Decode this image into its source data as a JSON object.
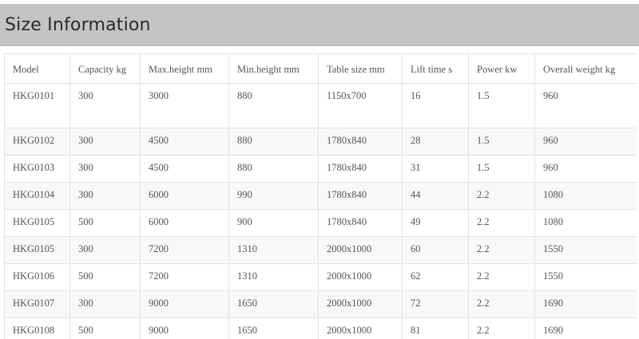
{
  "section": {
    "title": "Size Information"
  },
  "table": {
    "headers": [
      "Model",
      "Capacity kg",
      "Max.height mm",
      "Min.height mm",
      "Table size mm",
      "Lift time s",
      "Power kw",
      "Overall weight kg"
    ],
    "rows": [
      [
        "HKG0101",
        "300",
        "3000",
        "880",
        "1150x700",
        "16",
        "1.5",
        "960"
      ],
      [
        "HKG0102",
        "300",
        "4500",
        "880",
        "1780x840",
        "28",
        "1.5",
        "960"
      ],
      [
        "HKG0103",
        "300",
        "4500",
        "880",
        "1780x840",
        "31",
        "1.5",
        "960"
      ],
      [
        "HKG0104",
        "300",
        "6000",
        "990",
        "1780x840",
        "44",
        "2.2",
        "1080"
      ],
      [
        "HKG0105",
        "500",
        "6000",
        "900",
        "1780x840",
        "49",
        "2.2",
        "1080"
      ],
      [
        "HKG0105",
        "300",
        "7200",
        "1310",
        "2000x1000",
        "60",
        "2.2",
        "1550"
      ],
      [
        "HKG0106",
        "500",
        "7200",
        "1310",
        "2000x1000",
        "62",
        "2.2",
        "1550"
      ],
      [
        "HKG0107",
        "300",
        "9000",
        "1650",
        "2000x1000",
        "72",
        "2.2",
        "1690"
      ],
      [
        "HKG0108",
        "500",
        "9000",
        "1650",
        "2000x1000",
        "81",
        "2.2",
        "1690"
      ]
    ]
  }
}
